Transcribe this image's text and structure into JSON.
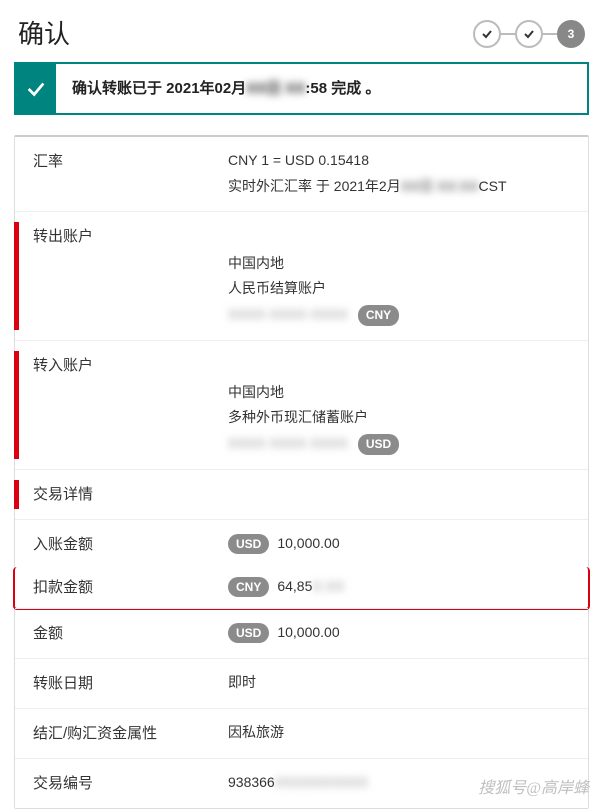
{
  "header": {
    "title": "确认",
    "step_active": "3"
  },
  "notice": {
    "prefix": "确认转账已于 2021年02月",
    "hidden": "XX日 XX",
    "suffix": ":58 完成 。"
  },
  "rate": {
    "label": "汇率",
    "line1": "CNY 1 = USD 0.15418",
    "line2_prefix": "实时外汇汇率 于 2021年2月",
    "line2_hidden": "XX日 XX:XX",
    "line2_suffix": " CST"
  },
  "from": {
    "label": "转出账户",
    "region": "中国内地",
    "account_type": "人民币结算账户",
    "hidden_number": "XXXX XXXX XXXX",
    "currency": "CNY"
  },
  "to": {
    "label": "转入账户",
    "region": "中国内地",
    "account_type": "多种外币现汇储蓄账户",
    "hidden_number": "XXXX XXXX XXXX",
    "currency": "USD"
  },
  "txn": {
    "section_label": "交易详情",
    "credit_label": "入账金额",
    "credit_currency": "USD",
    "credit_amount": "10,000.00",
    "debit_label": "扣款金额",
    "debit_currency": "CNY",
    "debit_amount": "64,85",
    "debit_hidden": "X.XX",
    "amount_label": "金额",
    "amount_currency": "USD",
    "amount_value": "10,000.00",
    "date_label": "转账日期",
    "date_value": "即时",
    "purpose_label": "结汇/购汇资金属性",
    "purpose_value": "因私旅游",
    "ref_label": "交易编号",
    "ref_value": "938366",
    "ref_hidden": "XXXXXXXXXX"
  },
  "watermark": "搜狐号@高岸蜂"
}
